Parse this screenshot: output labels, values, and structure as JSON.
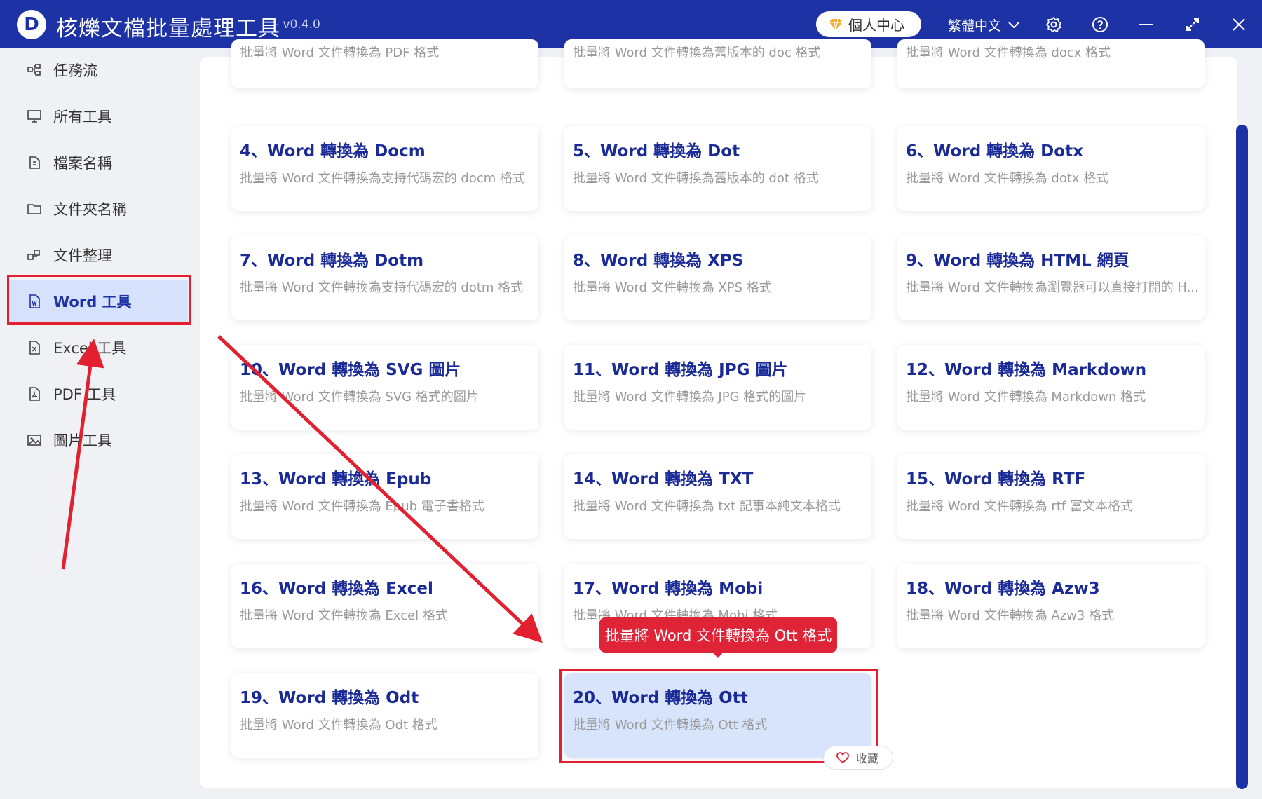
{
  "titlebar": {
    "app_title": "核爍文檔批量處理工具",
    "version": "- v0.4.0",
    "profile_label": "個人中心",
    "language": "繁體中文"
  },
  "sidebar": {
    "items": [
      {
        "label": "任務流",
        "icon": "workflow-icon"
      },
      {
        "label": "所有工具",
        "icon": "monitor-icon"
      },
      {
        "label": "檔案名稱",
        "icon": "file-name-icon"
      },
      {
        "label": "文件夾名稱",
        "icon": "folder-icon"
      },
      {
        "label": "文件整理",
        "icon": "organize-icon"
      },
      {
        "label": "Word 工具",
        "icon": "word-file-icon",
        "active": true
      },
      {
        "label": "Excel 工具",
        "icon": "excel-file-icon"
      },
      {
        "label": "PDF 工具",
        "icon": "pdf-file-icon"
      },
      {
        "label": "圖片工具",
        "icon": "image-icon"
      }
    ]
  },
  "cards": [
    {
      "title": "",
      "desc": "批量將 Word 文件轉換為 PDF 格式"
    },
    {
      "title": "",
      "desc": "批量將 Word 文件轉換為舊版本的 doc 格式"
    },
    {
      "title": "",
      "desc": "批量將 Word 文件轉換為 docx 格式"
    },
    {
      "title": "4、Word 轉換為 Docm",
      "desc": "批量將 Word 文件轉換為支持代碼宏的 docm 格式"
    },
    {
      "title": "5、Word 轉換為 Dot",
      "desc": "批量將 Word 文件轉換為舊版本的 dot 格式"
    },
    {
      "title": "6、Word 轉換為 Dotx",
      "desc": "批量將 Word 文件轉換為 dotx 格式"
    },
    {
      "title": "7、Word 轉換為 Dotm",
      "desc": "批量將 Word 文件轉換為支持代碼宏的 dotm 格式"
    },
    {
      "title": "8、Word 轉換為 XPS",
      "desc": "批量將 Word 文件轉換為 XPS 格式"
    },
    {
      "title": "9、Word 轉換為 HTML 網頁",
      "desc": "批量將 Word 文件轉換為瀏覽器可以直接打開的 H..."
    },
    {
      "title": "10、Word 轉換為 SVG 圖片",
      "desc": "批量將 Word 文件轉換為 SVG 格式的圖片"
    },
    {
      "title": "11、Word 轉換為 JPG 圖片",
      "desc": "批量將 Word 文件轉換為 JPG 格式的圖片"
    },
    {
      "title": "12、Word 轉換為 Markdown",
      "desc": "批量將 Word 文件轉換為 Markdown 格式"
    },
    {
      "title": "13、Word 轉換為 Epub",
      "desc": "批量將 Word 文件轉換為 Epub 電子書格式"
    },
    {
      "title": "14、Word 轉換為 TXT",
      "desc": "批量將 Word 文件轉換為 txt 記事本純文本格式"
    },
    {
      "title": "15、Word 轉換為 RTF",
      "desc": "批量將 Word 文件轉換為 rtf 富文本格式"
    },
    {
      "title": "16、Word 轉換為 Excel",
      "desc": "批量將 Word 文件轉換為 Excel 格式"
    },
    {
      "title": "17、Word 轉換為 Mobi",
      "desc": "批量將 Word 文件轉換為 Mobi 格式"
    },
    {
      "title": "18、Word 轉換為 Azw3",
      "desc": "批量將 Word 文件轉換為 Azw3 格式"
    },
    {
      "title": "19、Word 轉換為 Odt",
      "desc": "批量將 Word 文件轉換為 Odt 格式"
    },
    {
      "title": "20、Word 轉換為 Ott",
      "desc": "批量將 Word 文件轉換為 Ott 格式",
      "selected": true
    }
  ],
  "tooltip": "批量將 Word 文件轉換為 Ott 格式",
  "favorite_label": "收藏",
  "colors": {
    "titlebar": "#1d32a5",
    "card_title": "#1a2a96",
    "active_bg": "#d6e1fb",
    "highlight": "#e32030"
  }
}
